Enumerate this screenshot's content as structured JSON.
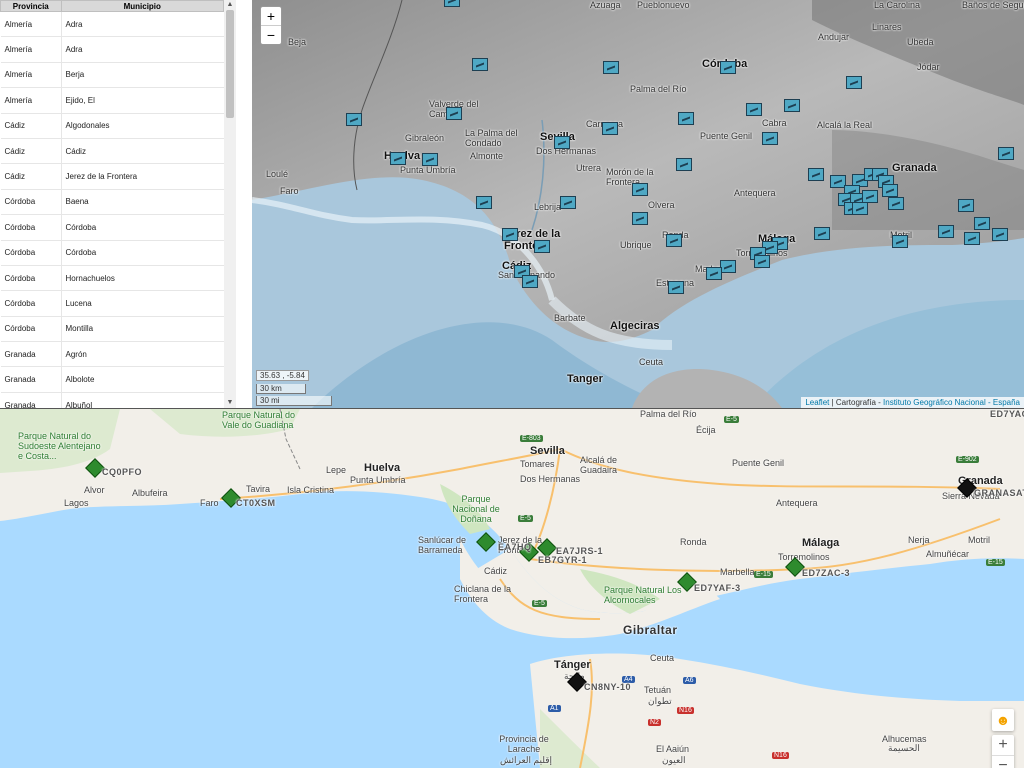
{
  "table": {
    "headers": [
      "Provincia",
      "Municipio"
    ],
    "rows": [
      [
        "Almería",
        "Adra"
      ],
      [
        "Almería",
        "Adra"
      ],
      [
        "Almería",
        "Berja"
      ],
      [
        "Almería",
        "Ejido, El"
      ],
      [
        "Cádiz",
        "Algodonales"
      ],
      [
        "Cádiz",
        "Cádiz"
      ],
      [
        "Cádiz",
        "Jerez de la Frontera"
      ],
      [
        "Córdoba",
        "Baena"
      ],
      [
        "Córdoba",
        "Córdoba"
      ],
      [
        "Córdoba",
        "Córdoba"
      ],
      [
        "Córdoba",
        "Hornachuelos"
      ],
      [
        "Córdoba",
        "Lucena"
      ],
      [
        "Córdoba",
        "Montilla"
      ],
      [
        "Granada",
        "Agrón"
      ],
      [
        "Granada",
        "Albolote"
      ],
      [
        "Granada",
        "Albuñol"
      ]
    ]
  },
  "top_map": {
    "zoom_in": "+",
    "zoom_out": "−",
    "coords": "35.63 , -5.84",
    "scale_km": "30 km",
    "scale_mi": "30 mi",
    "attribution_leaflet": "Leaflet",
    "attribution_sep": " | Cartografía - ",
    "attribution_ign": "Instituto Geográfico Nacional - España",
    "labels": {
      "azuaga": "Azuaga",
      "pueblonuevo": "Pueblonuevo",
      "andujar": "Andujar",
      "linares": "Linares",
      "la_carolina": "La Carolina",
      "banos_segura": "Baños de Segura",
      "beja": "Beja",
      "cordoba": "Córdoba",
      "ubeda": "Ubeda",
      "jodar": "Jódar",
      "palma_rio": "Palma del Río",
      "valverde": "Valverde del Camino",
      "gibraleon": "Gibraleón",
      "la_palma": "La Palma del Condado",
      "sevilla": "Sevilla",
      "carmona": "Carmona",
      "cabra": "Cabra",
      "alcala_real": "Alcalá la Real",
      "puente_genil": "Puente Genil",
      "huelva": "Huelva",
      "punta_umbria": "Punta Umbría",
      "almonte": "Almonte",
      "dos_hermanas": "Dos Hermanas",
      "utrera": "Utrera",
      "moron": "Morón de la Frontera",
      "loule": "Loulé",
      "faro": "Faro",
      "antequera": "Antequera",
      "granada": "Granada",
      "olvera": "Olvera",
      "lebrija": "Lebrija",
      "jerez": "Jerez de la Frontera",
      "ubrique": "Ubrique",
      "ronda": "Ronda",
      "malaga": "Málaga",
      "torremolinos": "Torremolinos",
      "motril": "Motril",
      "cadiz": "Cádiz",
      "san_fernando": "San Fernando",
      "estepona": "Estepona",
      "marbella": "Marbella",
      "barbate": "Barbate",
      "algeciras": "Algeciras",
      "ceuta": "Ceuta",
      "tanger": "Tanger"
    }
  },
  "bottom_map": {
    "labels": {
      "pn_vale": "Parque Natural do Vale do Guadiana",
      "pn_sudoeste": "Parque Natural do Sudoeste Alentejano e Costa...",
      "sevilla": "Sevilla",
      "ecija": "Écija",
      "tomares": "Tomares",
      "alcala": "Alcalá de Guadaira",
      "puente_genil": "Puente Genil",
      "granada": "Granada",
      "sierra_nevada": "Sierra Nevada",
      "lepe": "Lepe",
      "huelva": "Huelva",
      "dos_hermanas": "Dos Hermanas",
      "punta_umbria": "Punta Umbría",
      "albufeira": "Albufeira",
      "tavira": "Tavira",
      "isla_cristina": "Isla Cristina",
      "alvor": "Alvor",
      "lagos": "Lagos",
      "faro": "Faro",
      "antequera": "Antequera",
      "pn_donana": "Parque Nacional de Doñana",
      "sanlucar": "Sanlúcar de Barrameda",
      "jerez": "Jerez de la Frontera",
      "ronda": "Ronda",
      "malaga": "Málaga",
      "nerja": "Nerja",
      "motril": "Motril",
      "almunecar": "Almuñécar",
      "torremolinos": "Torremolinos",
      "marbella": "Marbella",
      "cadiz": "Cádiz",
      "chiclana": "Chiclana de la Frontera",
      "pn_alcornocales": "Parque Natural Los Alcornocales",
      "gibraltar": "Gibraltar",
      "tanger": "Tánger",
      "tanger_ar": "طنجة",
      "ceuta": "Ceuta",
      "tetuan": "Tetuán",
      "tetuan_ar": "تطوان",
      "larache": "Provincia de Larache",
      "larache_ar": "إقليم العرائش",
      "el_aaiun": "El Aaiún",
      "el_aaiun_ar": "العيون",
      "alhucemas": "Alhucemas",
      "alhucemas_ar": "الحسيمة",
      "palma_rio": "Palma del Río",
      "cq0pfo": "CQ0PFO",
      "ct0xsm": "CT0XSM",
      "ea7jrs": "EA7JRS-1",
      "eb7gyr": "EB7GYR-1",
      "ed7yaf": "ED7YAF-3",
      "ed7zac": "ED7ZAC-3",
      "ea7hq": "EA7HQ",
      "granasat": "GRANASAT",
      "ed7yag": "ED7YAG",
      "cn8ny": "CN8NY-10"
    },
    "roads": {
      "e803": "E-803",
      "e5a": "E-5",
      "e5b": "E-5",
      "e5c": "E-5",
      "e902": "E-902",
      "e15a": "E-15",
      "e15b": "E-15",
      "a1": "A1",
      "a4": "A4",
      "a6": "A6",
      "n2": "N2",
      "n16a": "N16",
      "n16b": "N16"
    },
    "pegman": "☻",
    "zoom_in": "+",
    "zoom_out": "−"
  }
}
